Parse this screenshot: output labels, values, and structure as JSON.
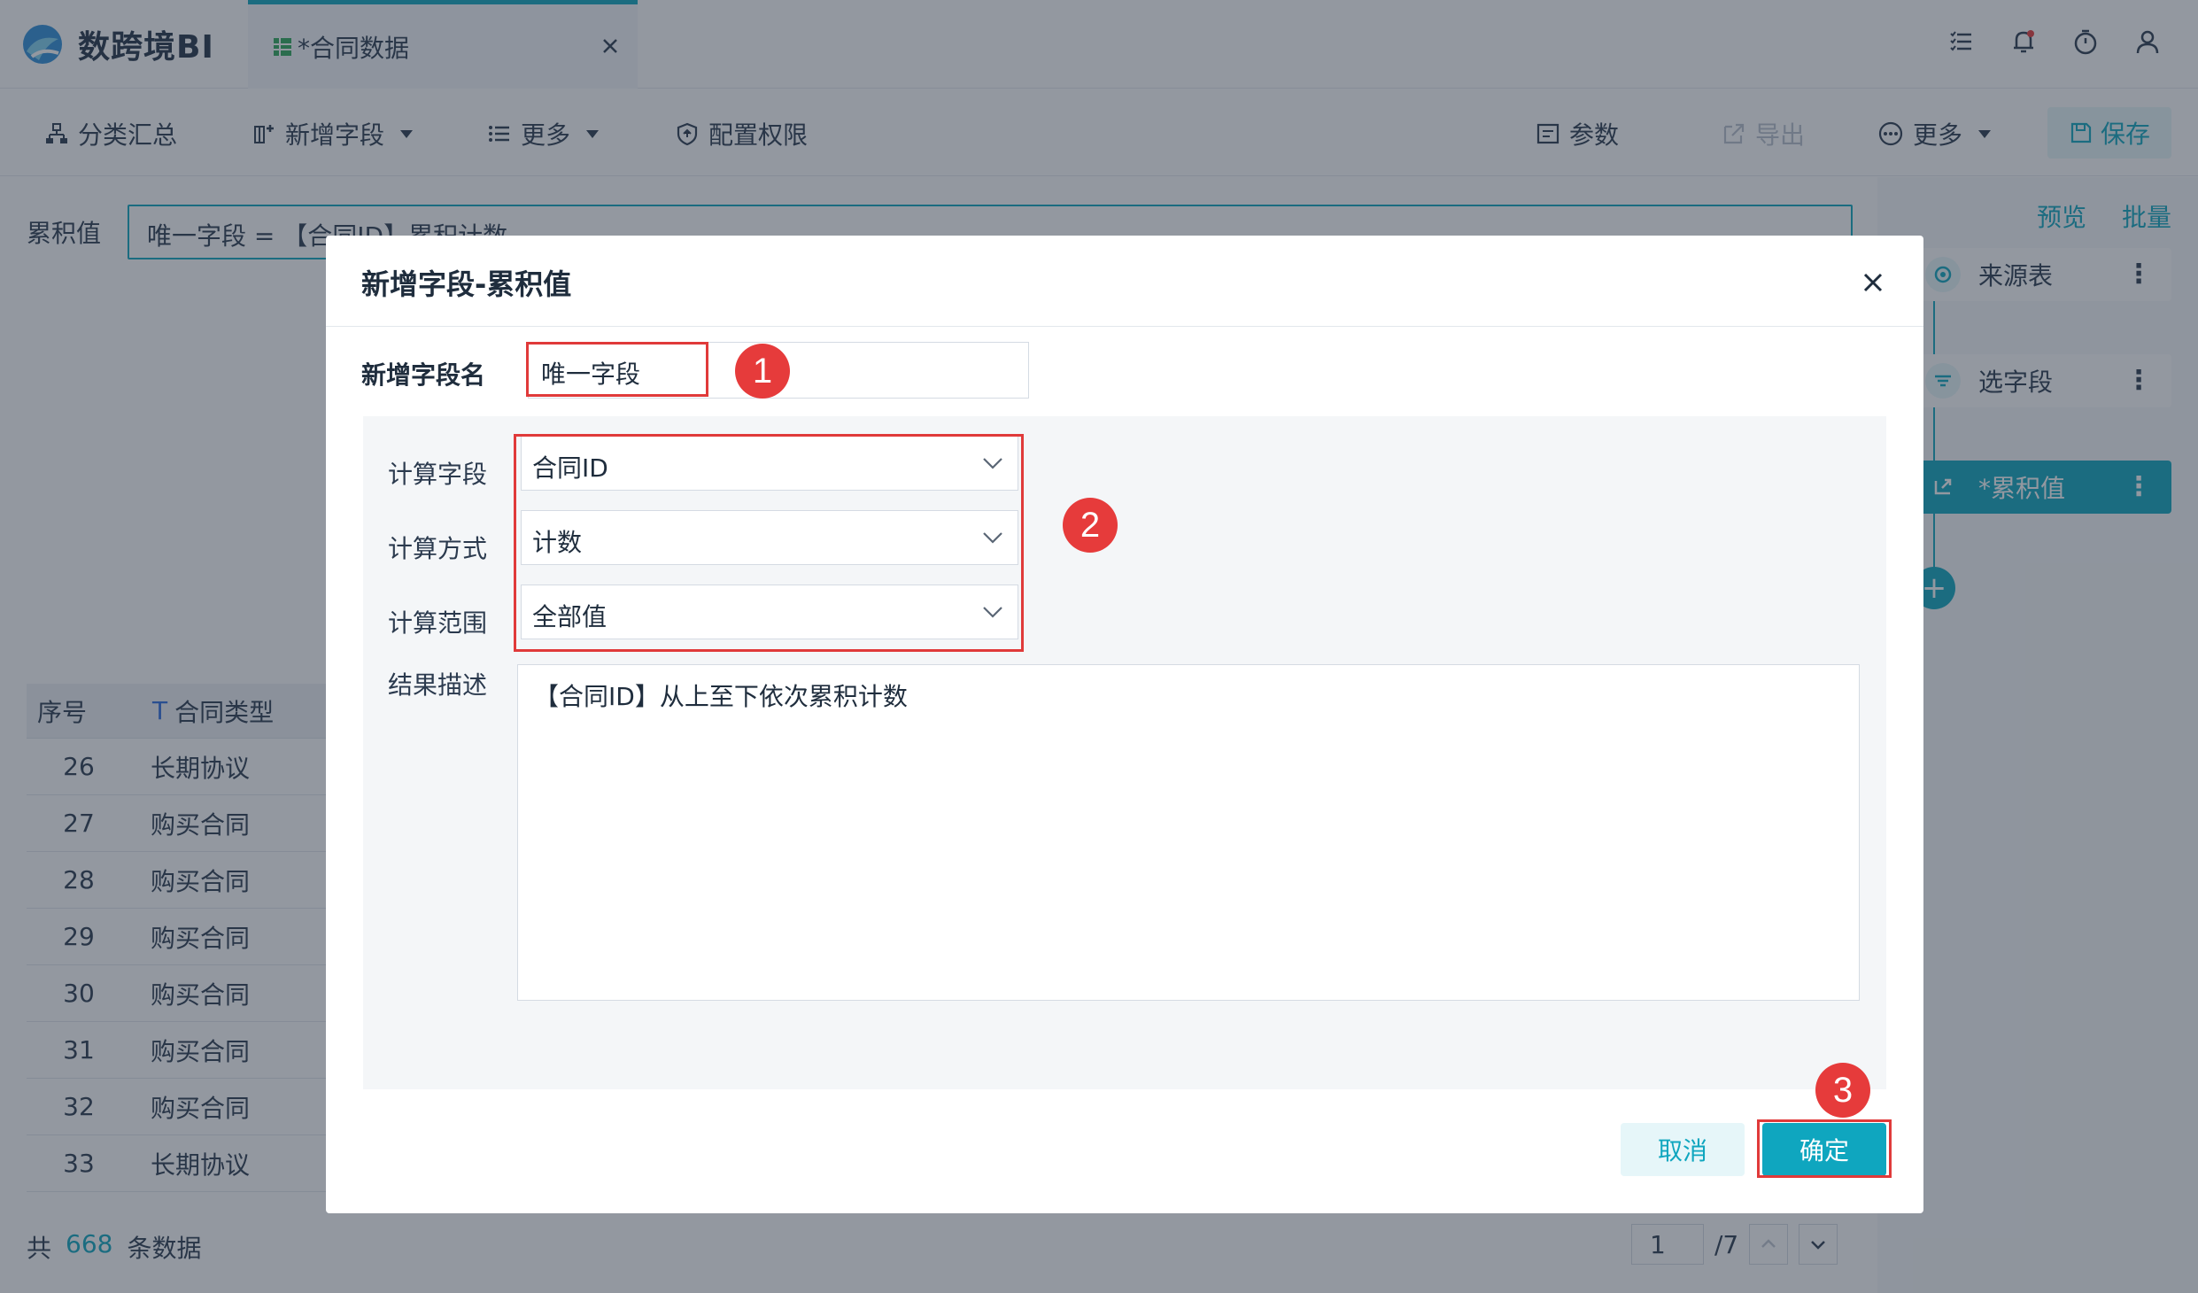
{
  "app": {
    "name": "数跨境BI"
  },
  "tab": {
    "title": "*合同数据"
  },
  "toolbar": {
    "group_label": "分类汇总",
    "add_field_label": "新增字段",
    "more_label": "更多",
    "permission_label": "配置权限",
    "params_label": "参数",
    "export_label": "导出",
    "more2_label": "更多",
    "save_label": "保存"
  },
  "formula": {
    "label": "累积值",
    "text": "唯一字段 = 【合同ID】累积计数"
  },
  "right_panel": {
    "preview_label": "预览",
    "batch_label": "批量",
    "nodes": [
      {
        "label": "来源表"
      },
      {
        "label": "选字段"
      },
      {
        "label": "*累积值"
      }
    ],
    "add_label": "+"
  },
  "table": {
    "headers": [
      "序号",
      "合同类型"
    ],
    "type_icon": "T",
    "rows": [
      {
        "idx": "26",
        "type": "长期协议"
      },
      {
        "idx": "27",
        "type": "购买合同"
      },
      {
        "idx": "28",
        "type": "购买合同"
      },
      {
        "idx": "29",
        "type": "购买合同"
      },
      {
        "idx": "30",
        "type": "购买合同"
      },
      {
        "idx": "31",
        "type": "购买合同"
      },
      {
        "idx": "32",
        "type": "购买合同"
      },
      {
        "idx": "33",
        "type": "长期协议"
      }
    ],
    "footer": {
      "prefix": "共",
      "count": "668",
      "suffix": "条数据"
    },
    "pager": {
      "current": "1",
      "total": "/7"
    }
  },
  "dialog": {
    "title": "新增字段-累积值",
    "name_label": "新增字段名",
    "name_value": "唯一字段",
    "calc_field_label": "计算字段",
    "calc_field_value": "合同ID",
    "calc_method_label": "计算方式",
    "calc_method_value": "计数",
    "calc_range_label": "计算范围",
    "calc_range_value": "全部值",
    "desc_label": "结果描述",
    "desc_value": "【合同ID】从上至下依次累积计数",
    "cancel_label": "取消",
    "ok_label": "确定"
  },
  "annotations": {
    "badge1": "1",
    "badge2": "2",
    "badge3": "3"
  },
  "colors": {
    "accent": "#0fa6bf",
    "highlight": "#e03a3a",
    "badge": "#e63b3b"
  }
}
